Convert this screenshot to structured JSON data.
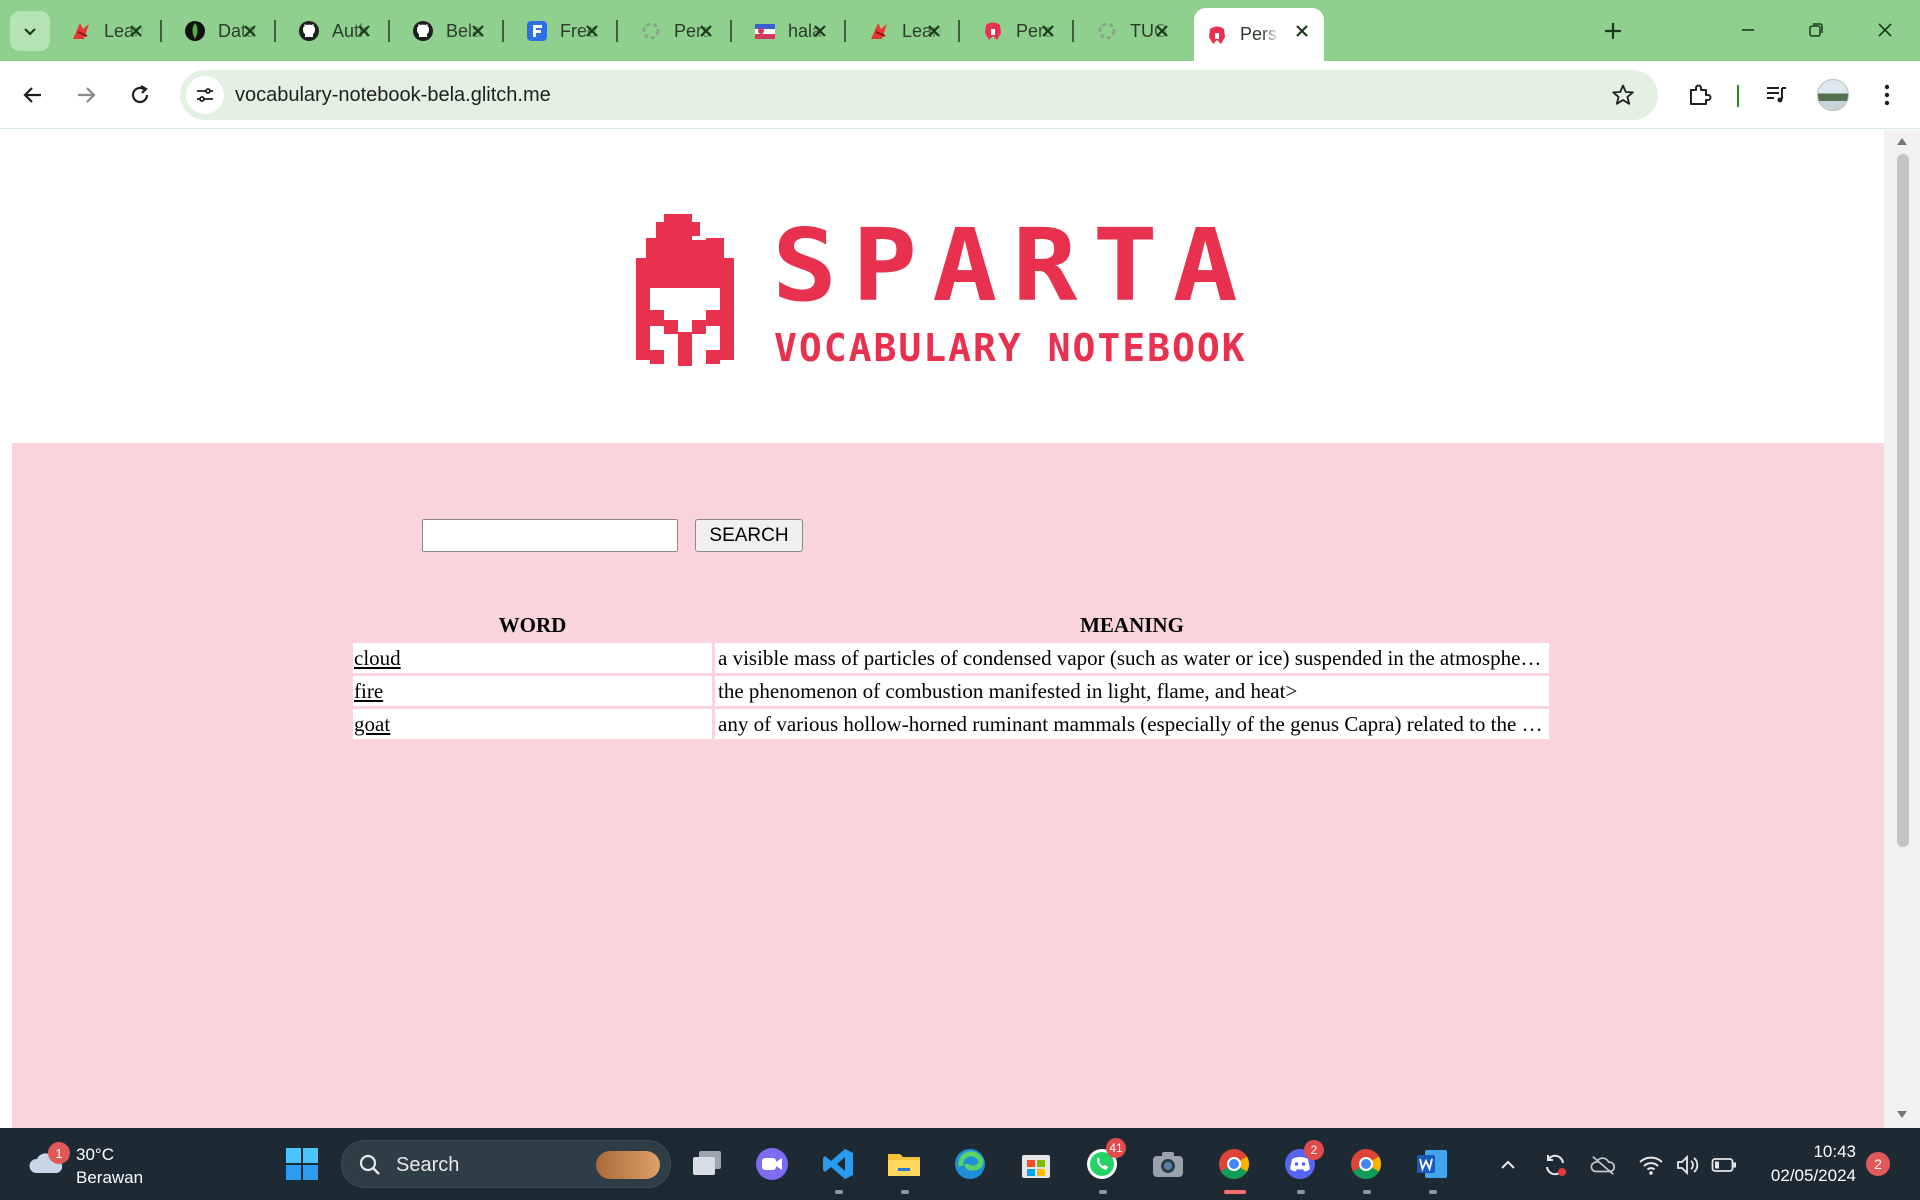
{
  "browser": {
    "tabs": [
      {
        "title": "Learn",
        "favicon": "sparta-red-icon",
        "active": false
      },
      {
        "title": "Data",
        "favicon": "mongodb-leaf-icon",
        "active": false
      },
      {
        "title": "Auth",
        "favicon": "github-icon",
        "active": false
      },
      {
        "title": "Bela",
        "favicon": "github-icon",
        "active": false
      },
      {
        "title": "Free",
        "favicon": "blue-f-icon",
        "active": false
      },
      {
        "title": "Pers",
        "favicon": "loading-gear-icon",
        "active": false
      },
      {
        "title": "hala",
        "favicon": "flag-icon",
        "active": false
      },
      {
        "title": "Learn",
        "favicon": "sparta-red-icon",
        "active": false
      },
      {
        "title": "Pers",
        "favicon": "red-helmet-icon",
        "active": false
      },
      {
        "title": "TUG",
        "favicon": "loading-gear-icon",
        "active": false
      },
      {
        "title": "Pers",
        "favicon": "red-helmet-icon",
        "active": true
      }
    ],
    "url": "vocabulary-notebook-bela.glitch.me",
    "colors": {
      "frame": "#8fd08f",
      "omnibox": "#e3f1e3",
      "brand": "#e8314f",
      "panel": "#f9d4dd"
    }
  },
  "page": {
    "logo": {
      "brand": "SPARTA",
      "subtitle": "VOCABULARY NOTEBOOK"
    },
    "search": {
      "input_value": "",
      "button_label": "SEARCH"
    },
    "table": {
      "headers": [
        "WORD",
        "MEANING"
      ],
      "rows": [
        {
          "word": "cloud",
          "meaning": "a visible mass of particles of condensed vapor (such as water or ice) suspended in the atmosphere of a planet or moon"
        },
        {
          "word": "fire",
          "meaning": "the phenomenon of combustion manifested in light, flame, and heat>"
        },
        {
          "word": "goat",
          "meaning": "any of various hollow-horned ruminant mammals (especially of the genus Capra) related to the sheep"
        }
      ]
    }
  },
  "taskbar": {
    "weather": {
      "temp": "30°C",
      "condition": "Berawan",
      "badge": "1"
    },
    "search_label": "Search",
    "whatsapp_badge": "41",
    "discord_badge": "2",
    "clock": {
      "time": "10:43",
      "date": "02/05/2024"
    },
    "notification_count": "2"
  }
}
